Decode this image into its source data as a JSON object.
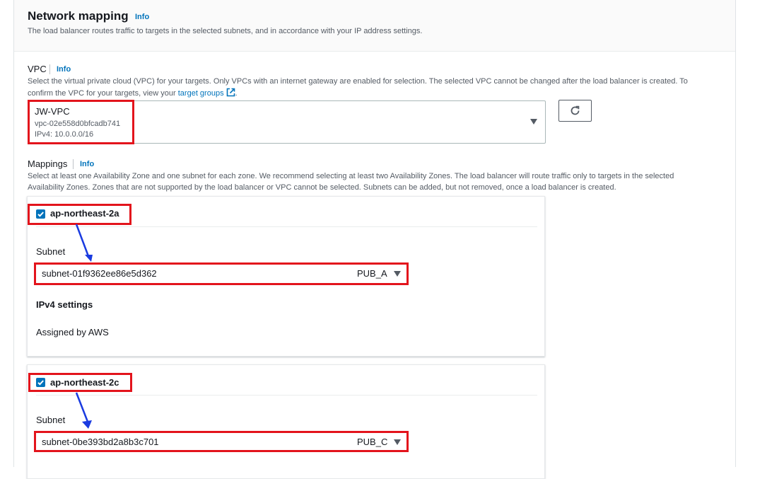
{
  "section": {
    "title": "Network mapping",
    "info": "Info",
    "description": "The load balancer routes traffic to targets in the selected subnets, and in accordance with your IP address settings."
  },
  "vpc": {
    "label": "VPC",
    "info": "Info",
    "description_line1": "Select the virtual private cloud (VPC) for your targets. Only VPCs with an internet gateway are enabled for selection. The selected VPC cannot be changed after the load balancer is created. To",
    "description_line2_prefix": "confirm the VPC for your targets, view your",
    "target_groups_link": "target groups",
    "description_line2_suffix": ".",
    "selected_name": "JW-VPC",
    "selected_id": "vpc-02e558d0bfcadb741",
    "selected_cidr": "IPv4: 10.0.0.0/16"
  },
  "mappings": {
    "label": "Mappings",
    "info": "Info",
    "description_line1": "Select at least one Availability Zone and one subnet for each zone. We recommend selecting at least two Availability Zones. The load balancer will route traffic only to targets in the selected",
    "description_line2": "Availability Zones. Zones that are not supported by the load balancer or VPC cannot be selected. Subnets can be added, but not removed, once a load balancer is created.",
    "zones": [
      {
        "name": "ap-northeast-2a",
        "checked": true,
        "subnet_label": "Subnet",
        "subnet_id": "subnet-01f9362ee86e5d362",
        "subnet_name": "PUB_A",
        "ipv4_heading": "IPv4 settings",
        "ipv4_value": "Assigned by AWS"
      },
      {
        "name": "ap-northeast-2c",
        "checked": true,
        "subnet_label": "Subnet",
        "subnet_id": "subnet-0be393bd2a8b3c701",
        "subnet_name": "PUB_C"
      }
    ]
  },
  "colors": {
    "link": "#0073bb",
    "highlight": "#e3141c",
    "annotation_arrow": "#1a3be0",
    "checkbox": "#0073bb"
  },
  "icons": [
    "external-link-icon",
    "refresh-icon",
    "caret-down-icon",
    "checkbox-checked-icon",
    "annotation-arrow-icon"
  ]
}
